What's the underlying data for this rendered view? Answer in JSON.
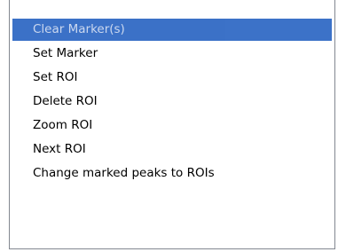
{
  "menu": {
    "items": [
      {
        "label": "Clear Marker(s)",
        "selected": true
      },
      {
        "label": "Set Marker"
      },
      {
        "label": "Set ROI"
      },
      {
        "label": "Delete ROI"
      },
      {
        "label": "Zoom ROI"
      },
      {
        "label": "Next ROI"
      },
      {
        "label": "Change marked peaks to ROIs"
      }
    ]
  },
  "colors": {
    "selection": "#316ac5",
    "border": "#828790",
    "background": "#ffffff"
  }
}
